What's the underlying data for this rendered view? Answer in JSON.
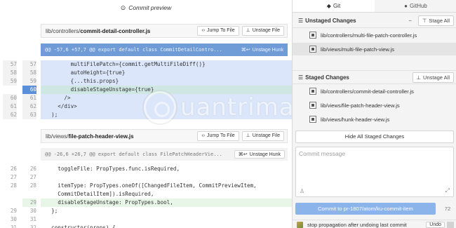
{
  "preview": {
    "title": "Commit preview",
    "title_icon": "eye-icon"
  },
  "file1": {
    "path_prefix": "lib/controllers/",
    "path_name": "commit-detail-controller.js",
    "jump_label": "Jump To File",
    "unstage_file_label": "Unstage File",
    "hunk": {
      "title": "@@ -57,6 +57,7 @@ export default class CommitDetailContro...",
      "stage_label": "Unstage Hunk"
    },
    "lines": [
      {
        "old": "57",
        "new": "57",
        "text": "        multiFilePatch={commit.getMultiFileDiff()}",
        "kind": "selctx"
      },
      {
        "old": "58",
        "new": "58",
        "text": "        autoHeight={true}",
        "kind": "selctx"
      },
      {
        "old": "59",
        "new": "59",
        "text": "        {...this.props}",
        "kind": "selctx"
      },
      {
        "old": "",
        "new": "60",
        "text": "        disableStageUnstage={true}",
        "kind": "seladd"
      },
      {
        "old": "60",
        "new": "61",
        "text": "      />",
        "kind": "selctx"
      },
      {
        "old": "61",
        "new": "62",
        "text": "    </div>",
        "kind": "selctx"
      },
      {
        "old": "62",
        "new": "63",
        "text": "  );",
        "kind": "selctx"
      }
    ]
  },
  "file2": {
    "path_prefix": "lib/views/",
    "path_name": "file-patch-header-view.js",
    "jump_label": "Jump To File",
    "unstage_file_label": "Unstage File",
    "hunk": {
      "title": "@@ -26,6 +26,7 @@ export default class FilePatchHeaderVie...",
      "stage_label": "Unstage Hunk"
    },
    "lines": [
      {
        "old": "26",
        "new": "26",
        "text": "    toggleFile: PropTypes.func.isRequired,",
        "kind": "ctx"
      },
      {
        "old": "27",
        "new": "27",
        "text": "",
        "kind": "ctx"
      },
      {
        "old": "28",
        "new": "28",
        "text": "    itemType: PropTypes.oneOf([ChangedFileItem, CommitPreviewItem,",
        "kind": "ctx"
      },
      {
        "old": "",
        "new": "",
        "text": "    CommitDetailItem]).isRequired,",
        "kind": "ctx"
      },
      {
        "old": "",
        "new": "29",
        "text": "    disableStageUnstage: PropTypes.bool,",
        "kind": "add"
      },
      {
        "old": "29",
        "new": "30",
        "text": "  };",
        "kind": "ctx"
      },
      {
        "old": "30",
        "new": "31",
        "text": "",
        "kind": "ctx"
      },
      {
        "old": "31",
        "new": "32",
        "text": "  constructor(props) {",
        "kind": "ctx"
      }
    ]
  },
  "tabs": {
    "git": "Git",
    "github": "GitHub"
  },
  "unstaged": {
    "title": "Unstaged Changes",
    "stage_all": "Stage All",
    "files": [
      "lib/controllers/multi-file-patch-controller.js",
      "lib/views/multi-file-patch-view.js"
    ]
  },
  "staged": {
    "title": "Staged Changes",
    "unstage_all": "Unstage All",
    "files": [
      "lib/controllers/commit-detail-controller.js",
      "lib/views/file-patch-header-view.js",
      "lib/views/hunk-header-view.js"
    ]
  },
  "hide_staged_label": "Hide All Staged Changes",
  "commit": {
    "placeholder": "Commit message",
    "button_label": "Commit to pr-1807/atom/ku-commit-item",
    "char_count": "72"
  },
  "recent": {
    "message": "stop propagation after undoing last commit",
    "undo_label": "Undo"
  },
  "watermark": {
    "text": "uantrimang"
  },
  "colors": {
    "selected_hunk": "#6f9bd6",
    "selected_line": "#dbe6fa",
    "added_line": "#e8f6e7",
    "commit_button": "#8ab4ea"
  }
}
